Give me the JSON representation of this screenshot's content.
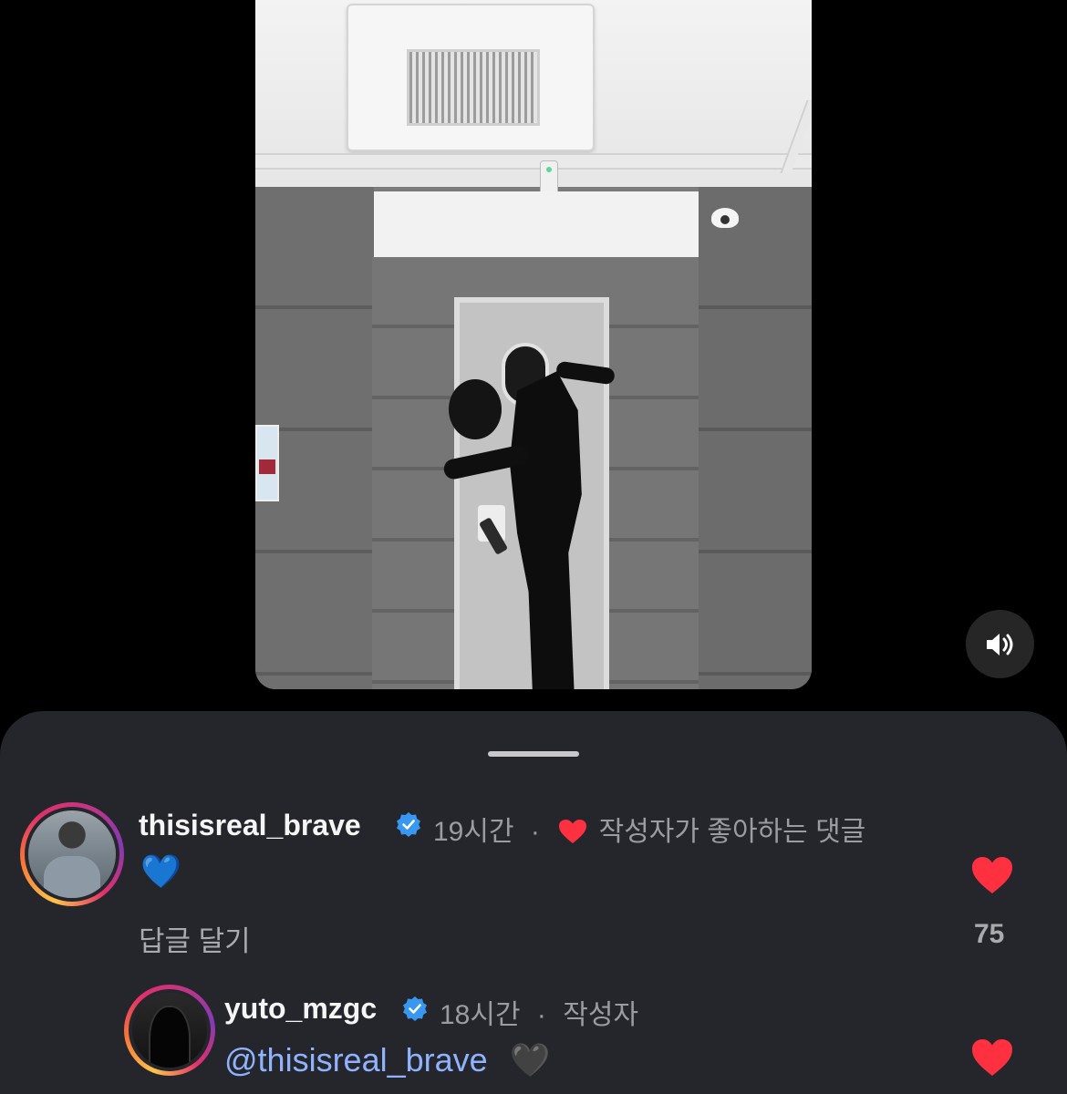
{
  "video": {
    "sound_icon": "speaker-icon"
  },
  "comments": [
    {
      "username": "thisisreal_brave",
      "time": "19시간",
      "separator": "·",
      "creator_liked_label": "작성자가 좋아하는 댓글",
      "text": "💙",
      "reply_label": "답글 달기",
      "like_count": "75",
      "liked": true
    }
  ],
  "replies": [
    {
      "username": "yuto_mzgc",
      "time": "18시간",
      "separator": "·",
      "author_label": "작성자",
      "mention": "@thisisreal_brave",
      "text": "🖤",
      "liked": true
    }
  ],
  "colors": {
    "sheet_bg": "#25262b",
    "heart": "#ff3040",
    "mention": "#8fb3ff",
    "verified": "#3897f0"
  }
}
